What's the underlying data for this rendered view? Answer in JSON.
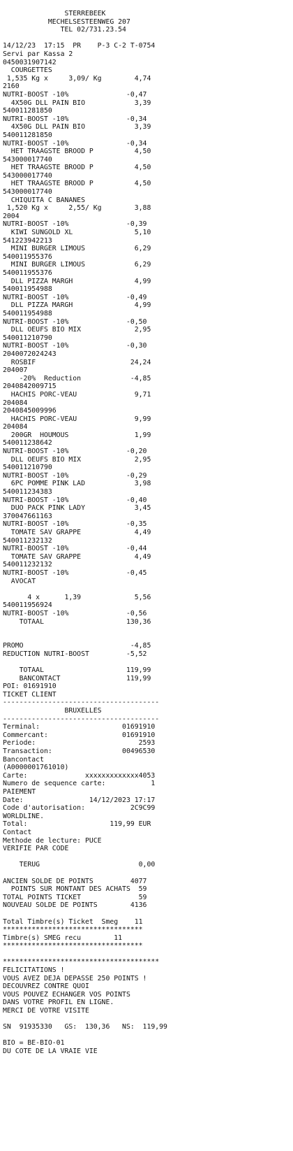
{
  "receipt": {
    "lines": [
      "               STERREBEEK",
      "           MECHELSESTEENWEG 207",
      "              TEL 02/731.23.54",
      "",
      "14/12/23  17:15  PR    P-3 C-2 T-0754",
      "Servi par Kassa 2",
      "0450031907142",
      "  COURGETTES",
      " 1,535 Kg x     3,09/ Kg        4,74",
      "2160",
      "NUTRI-BOOST -10%              -0,47",
      "  4X50G DLL PAIN BIO            3,39",
      "540011281850",
      "NUTRI-BOOST -10%              -0,34",
      "  4X50G DLL PAIN BIO            3,39",
      "540011281850",
      "NUTRI-BOOST -10%              -0,34",
      "  HET TRAAGSTE BROOD P          4,50",
      "543000017740",
      "  HET TRAAGSTE BROOD P          4,50",
      "543000017740",
      "  HET TRAAGSTE BROOD P          4,50",
      "543000017740",
      "  CHIQUITA C BANANES",
      " 1,520 Kg x     2,55/ Kg        3,88",
      "2004",
      "NUTRI-BOOST -10%              -0,39",
      "  KIWI SUNGOLD XL               5,10",
      "541223942213",
      "  MINI BURGER LIMOUS            6,29",
      "540011955376",
      "  MINI BURGER LIMOUS            6,29",
      "540011955376",
      "  DLL PIZZA MARGH               4,99",
      "540011954988",
      "NUTRI-BOOST -10%              -0,49",
      "  DLL PIZZA MARGH               4,99",
      "540011954988",
      "NUTRI-BOOST -10%              -0,50",
      "  DLL OEUFS BIO MIX             2,95",
      "540011210790",
      "NUTRI-BOOST -10%              -0,30",
      "2040072024243",
      "  ROSBIF                       24,24",
      "204007",
      "    -20%  Reduction            -4,85",
      "2040842009715",
      "  HACHIS PORC-VEAU              9,71",
      "204084",
      "2040845009996",
      "  HACHIS PORC-VEAU              9,99",
      "204084",
      "  200GR  HOUMOUS                1,99",
      "540011238642",
      "NUTRI-BOOST -10%              -0,20",
      "  DLL OEUFS BIO MIX             2,95",
      "540011210790",
      "NUTRI-BOOST -10%              -0,29",
      "  6PC POMME PINK LAD            3,98",
      "540011234383",
      "NUTRI-BOOST -10%              -0,40",
      "  DUO PACK PINK LADY            3,45",
      "370047661163",
      "NUTRI-BOOST -10%              -0,35",
      "  TOMATE SAV GRAPPE             4,49",
      "540011232132",
      "NUTRI-BOOST -10%              -0,44",
      "  TOMATE SAV GRAPPE             4,49",
      "540011232132",
      "NUTRI-BOOST -10%              -0,45",
      "  AVOCAT",
      "",
      "      4 x      1,39             5,56",
      "540011956924",
      "NUTRI-BOOST -10%              -0,56",
      "    TOTAAL                    130,36",
      "",
      "",
      "PROMO                          -4,85",
      "REDUCTION NUTRI-BOOST         -5,52",
      "",
      "    TOTAAL                    119,99",
      "    BANCONTACT                119,99",
      "POI: 01691910",
      "TICKET CLIENT",
      "--------------------------------------",
      "               BRUXELLES",
      "--------------------------------------",
      "Terminal:                    01691910",
      "Commercant:                  01691910",
      "Periode:                         2593",
      "Transaction:                 00496530",
      "Bancontact",
      "(A0000001761010)",
      "Carte:              xxxxxxxxxxxxx4053",
      "Numero de sequence carte:           1",
      "PAIEMENT",
      "Date:                14/12/2023 17:17",
      "Code d'autorisation:           2C9C99",
      "WORLDLINE.",
      "Total:                    119,99 EUR",
      "Contact",
      "Methode de lecture: PUCE",
      "VERIFIE PAR CODE",
      "",
      "    TERUG                        0,00",
      "",
      "ANCIEN SOLDE DE POINTS         4077",
      "  POINTS SUR MONTANT DES ACHATS  59",
      "TOTAL POINTS TICKET              59",
      "NOUVEAU SOLDE DE POINTS        4136",
      "",
      "Total Timbre(s) Ticket  Smeg    11",
      "**********************************",
      "Timbre(s) SMEG recu        11",
      "**********************************",
      "",
      "**************************************",
      "FELICITATIONS !",
      "VOUS AVEZ DEJA DEPASSE 250 POINTS !",
      "DECOUVREZ CONTRE QUOI",
      "VOUS POUVEZ ECHANGER VOS POINTS",
      "DANS VOTRE PROFIL EN LIGNE.",
      "MERCI DE VOTRE VISITE",
      "",
      "SN  91935330   GS:  130,36   NS:  119,99",
      "",
      "BIO = BE-BIO-01",
      "DU COTE DE LA VRAIE VIE"
    ]
  }
}
